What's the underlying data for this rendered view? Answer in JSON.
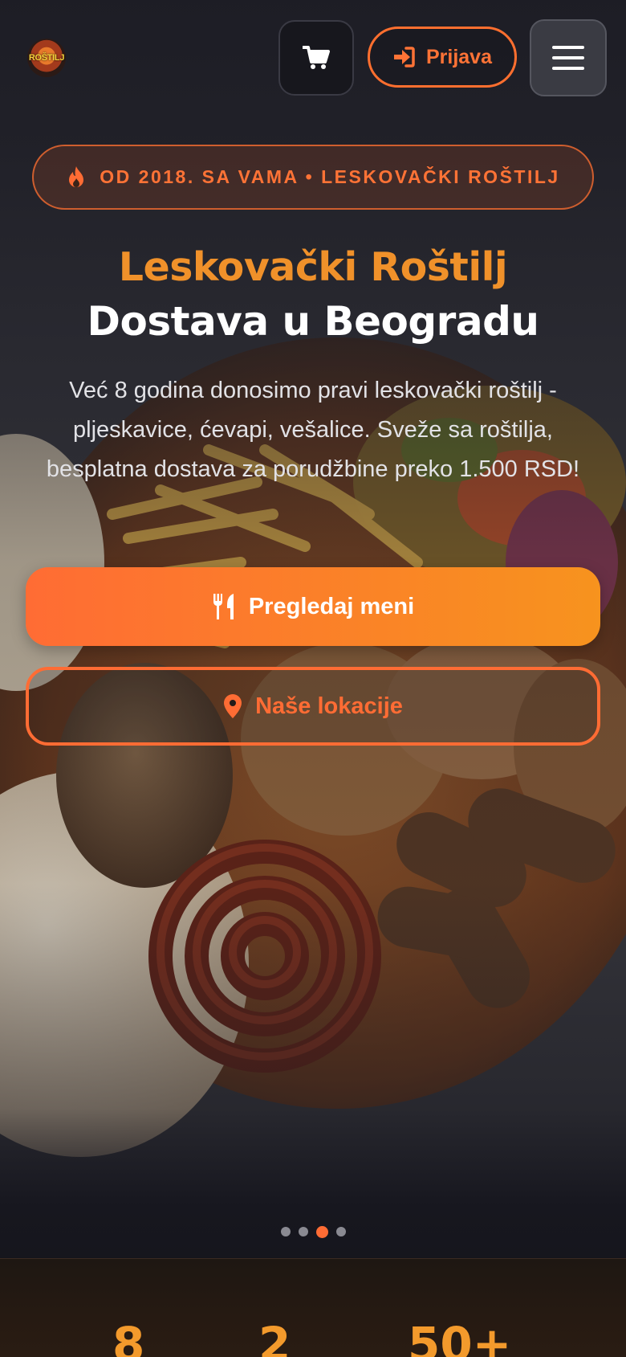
{
  "header": {
    "logo_text": "ROŠTILJ",
    "cart_icon": "cart-icon",
    "login_label": "Prijava",
    "login_icon": "sign-in-icon",
    "menu_icon": "hamburger-icon"
  },
  "hero": {
    "badge": "OD 2018. SA VAMA • LESKOVAČKI ROŠTILJ",
    "badge_icon": "fire-icon",
    "title_line1": "Leskovački Roštilj",
    "title_line2": "Dostava u Beogradu",
    "description": "Već 8 godina donosimo pravi leskovački roštilj - pljeskavice, ćevapi, vešalice. Sveže sa roštilja, besplatna dostava za porudžbine preko 1.500 RSD!",
    "primary_cta": "Pregledaj meni",
    "primary_cta_icon": "utensils-icon",
    "secondary_cta": "Naše lokacije",
    "secondary_cta_icon": "map-pin-icon",
    "slides": {
      "count": 4,
      "active_index": 3
    }
  },
  "stats": [
    {
      "value": "8"
    },
    {
      "value": "2"
    },
    {
      "value": "50+"
    }
  ],
  "colors": {
    "accent": "#ff6c34",
    "accent_secondary": "#f7931e",
    "title_orange": "#f0912a",
    "background": "#15151c"
  }
}
